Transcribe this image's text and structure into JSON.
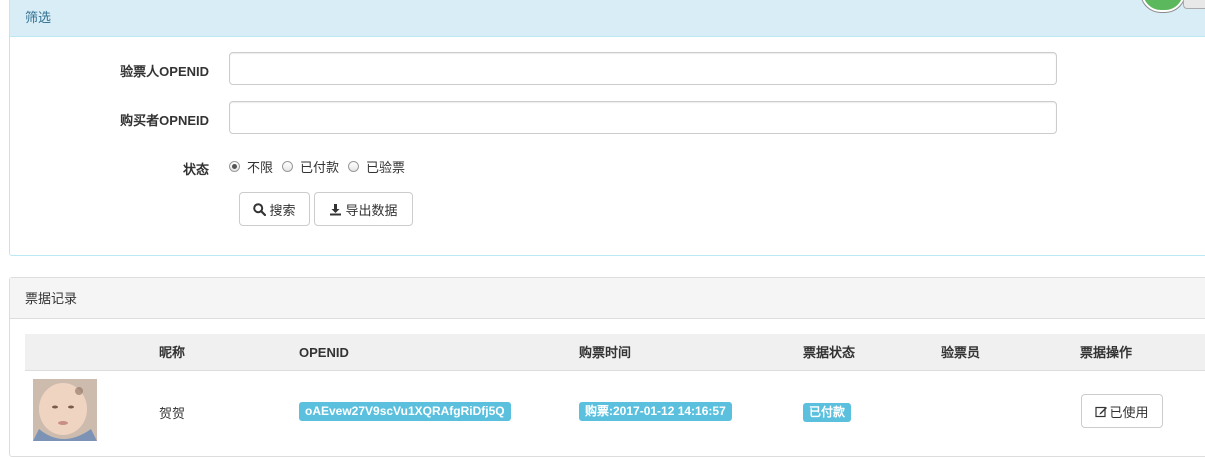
{
  "filter": {
    "title": "筛选",
    "verifier_openid_label": "验票人OPENID",
    "verifier_openid_value": "",
    "buyer_openid_label": "购买者OPNEID",
    "buyer_openid_value": "",
    "status_label": "状态",
    "status_options": [
      {
        "label": "不限",
        "checked": true
      },
      {
        "label": "已付款",
        "checked": false
      },
      {
        "label": "已验票",
        "checked": false
      }
    ],
    "search_label": "搜索",
    "export_label": "导出数据"
  },
  "records": {
    "title": "票据记录",
    "columns": [
      "昵称",
      "OPENID",
      "购票时间",
      "票据状态",
      "验票员",
      "票据操作"
    ],
    "rows": [
      {
        "nickname": "贺贺",
        "openid": "oAEvew27V9scVu1XQRAfgRiDfj5Q",
        "purchase_time": "购票:2017-01-12 14:16:57",
        "status": "已付款",
        "verifier": "",
        "action": "已使用"
      }
    ]
  },
  "colors": {
    "info_label": "#5bc0de",
    "filter_heading_bg": "#d9edf7",
    "filter_heading_text": "#31708f",
    "bubble": "#5cb85c"
  }
}
